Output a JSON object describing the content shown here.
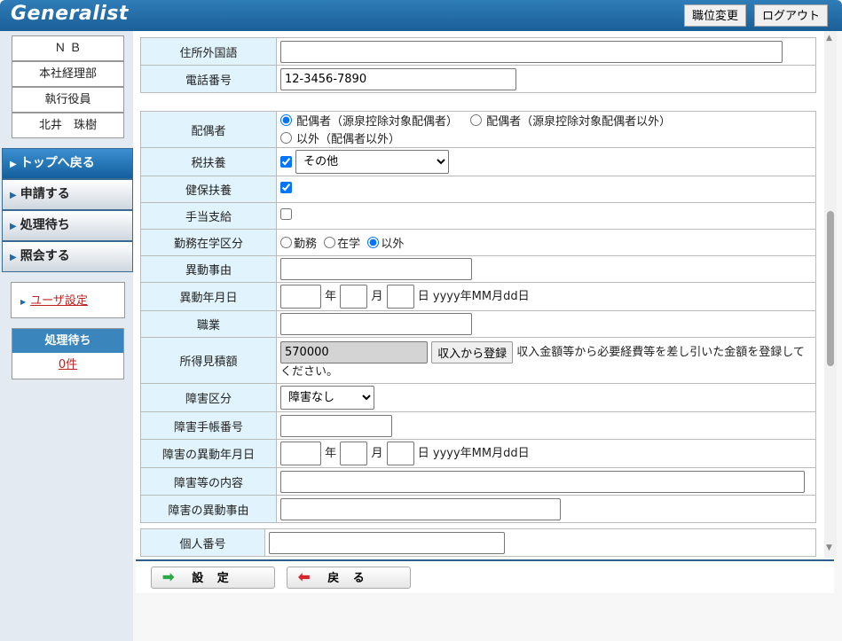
{
  "header": {
    "logo": "Generalist",
    "position_change": "職位変更",
    "logout": "ログアウト"
  },
  "sidebar": {
    "info": [
      "Ｎ Ｂ",
      "本社経理部",
      "執行役員",
      "北井　珠樹"
    ],
    "nav": [
      {
        "label": "トップへ戻る",
        "active": true
      },
      {
        "label": "申請する"
      },
      {
        "label": "処理待ち"
      },
      {
        "label": "照会する"
      }
    ],
    "user_settings": "ユーザ設定",
    "pending_title": "処理待ち",
    "pending_count": "0件"
  },
  "form": {
    "addr_foreign": {
      "label": "住所外国語",
      "value": ""
    },
    "phone": {
      "label": "電話番号",
      "value": "12-3456-7890"
    },
    "spouse": {
      "label": "配偶者",
      "options": [
        "配偶者（源泉控除対象配偶者）",
        "配偶者（源泉控除対象配偶者以外）",
        "以外（配偶者以外）"
      ],
      "selected": 0
    },
    "tax_dep": {
      "label": "税扶養",
      "checked": true,
      "select": "その他"
    },
    "health_dep": {
      "label": "健保扶養",
      "checked": true
    },
    "allowance": {
      "label": "手当支給",
      "checked": false
    },
    "work_study": {
      "label": "勤務在学区分",
      "options": [
        "勤務",
        "在学",
        "以外"
      ],
      "selected": 2
    },
    "change_reason": {
      "label": "異動事由",
      "value": ""
    },
    "change_date": {
      "label": "異動年月日",
      "year": "年",
      "month": "月",
      "day": "日",
      "format": "yyyy年MM月dd日"
    },
    "occupation": {
      "label": "職業",
      "value": ""
    },
    "income": {
      "label": "所得見積額",
      "value": "570000",
      "button": "収入から登録",
      "note": "収入金額等から必要経費等を差し引いた金額を登録してください。"
    },
    "disability": {
      "label": "障害区分",
      "select": "障害なし"
    },
    "disability_book": {
      "label": "障害手帳番号",
      "value": ""
    },
    "disability_date": {
      "label": "障害の異動年月日",
      "year": "年",
      "month": "月",
      "day": "日",
      "format": "yyyy年MM月dd日"
    },
    "disability_detail": {
      "label": "障害等の内容",
      "value": ""
    },
    "disability_reason": {
      "label": "障害の異動事由",
      "value": ""
    },
    "my_number": {
      "label": "個人番号",
      "value": ""
    }
  },
  "actions": {
    "set": "設 定",
    "back": "戻 る"
  }
}
